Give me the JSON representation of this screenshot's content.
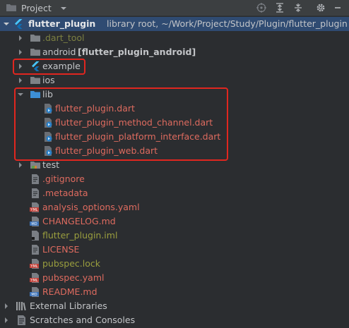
{
  "header": {
    "title": "Project",
    "icons": [
      "folder-icon",
      "chevron-down-icon",
      "target-icon",
      "expand-all-icon",
      "collapse-all-icon",
      "gear-icon",
      "minimize-icon"
    ]
  },
  "tree": {
    "root": {
      "name": "flutter_plugin",
      "suffix": "library root, ~/Work/Project/Study/Plugin/flutter_plugin"
    },
    "items": [
      {
        "label": ".dart_tool",
        "icon": "folder-icon"
      },
      {
        "label": "android",
        "suffix": "[flutter_plugin_android]",
        "icon": "folder-icon"
      },
      {
        "label": "example",
        "icon": "flutter-icon"
      },
      {
        "label": "ios",
        "icon": "folder-icon"
      },
      {
        "label": "lib",
        "icon": "folder-icon"
      },
      {
        "label": "flutter_plugin.dart",
        "icon": "dart-file-icon"
      },
      {
        "label": "flutter_plugin_method_channel.dart",
        "icon": "dart-file-icon"
      },
      {
        "label": "flutter_plugin_platform_interface.dart",
        "icon": "dart-file-icon"
      },
      {
        "label": "flutter_plugin_web.dart",
        "icon": "dart-file-icon"
      },
      {
        "label": "test",
        "icon": "test-folder-icon"
      },
      {
        "label": ".gitignore",
        "icon": "text-file-icon"
      },
      {
        "label": ".metadata",
        "icon": "text-file-icon"
      },
      {
        "label": "analysis_options.yaml",
        "icon": "yaml-file-icon"
      },
      {
        "label": "CHANGELOG.md",
        "icon": "markdown-file-icon"
      },
      {
        "label": "flutter_plugin.iml",
        "icon": "iml-file-icon"
      },
      {
        "label": "LICENSE",
        "icon": "text-file-icon"
      },
      {
        "label": "pubspec.lock",
        "icon": "yaml-file-icon"
      },
      {
        "label": "pubspec.yaml",
        "icon": "yaml-file-icon"
      },
      {
        "label": "README.md",
        "icon": "markdown-file-icon"
      },
      {
        "label": "External Libraries",
        "icon": "libraries-icon"
      },
      {
        "label": "Scratches and Consoles",
        "icon": "scratches-icon"
      }
    ]
  },
  "colors": {
    "background": "#2b2d30",
    "selection": "#2f4b72",
    "highlight_border": "#e0261f",
    "modified_red": "#de6b5f",
    "ignored_olive": "#9a9e3e"
  }
}
